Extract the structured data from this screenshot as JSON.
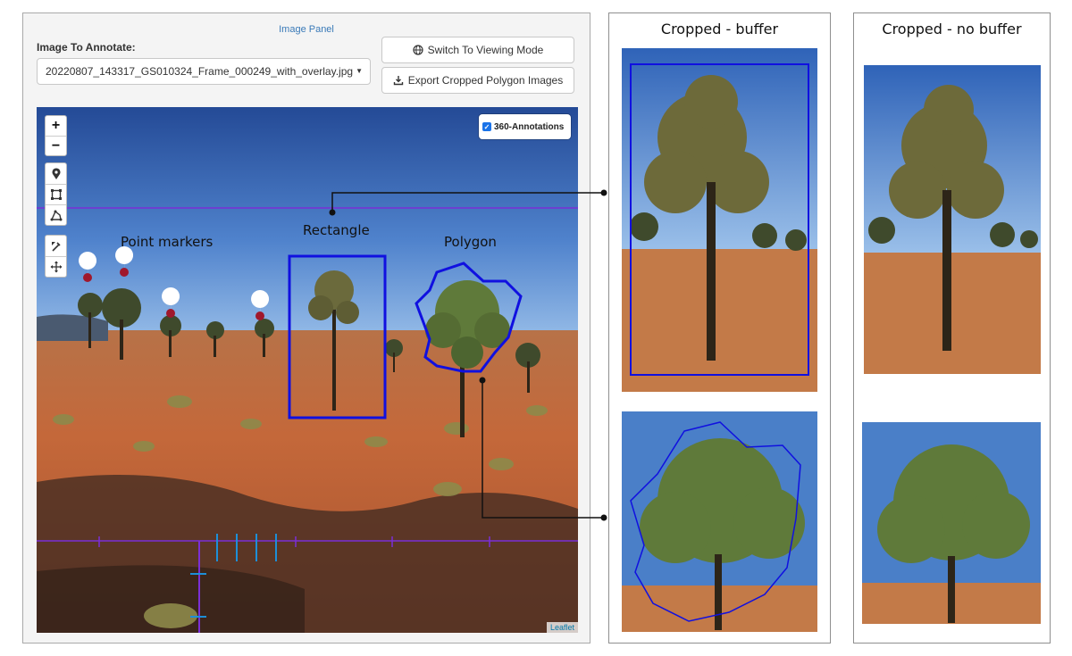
{
  "panel": {
    "title": "Image Panel",
    "image_label": "Image To Annotate:",
    "image_value": "20220807_143317_GS010324_Frame_000249_with_overlay.jpg",
    "switch_button": "Switch To Viewing Mode",
    "export_button": "Export Cropped Polygon Images"
  },
  "map": {
    "zoom_in": "+",
    "zoom_out": "−",
    "layer_toggle": "360-Annotations",
    "attribution": "Leaflet",
    "labels": {
      "points": "Point markers",
      "rectangle": "Rectangle",
      "polygon": "Polygon"
    }
  },
  "right": {
    "buffer_title": "Cropped - buffer",
    "nobuffer_title": "Cropped - no buffer"
  },
  "colors": {
    "sky_top": "#2a4f9a",
    "sky_horizon": "#8fb8e6",
    "ground": "#c4683a",
    "rect_stroke": "#1010e0",
    "guide_line": "#7b2fd6",
    "marker": "#a0182c"
  },
  "icons": [
    "globe-icon",
    "download-icon",
    "marker-tool-icon",
    "rectangle-tool-icon",
    "polygon-tool-icon",
    "edit-tool-icon",
    "move-tool-icon",
    "map-pin-icon"
  ]
}
